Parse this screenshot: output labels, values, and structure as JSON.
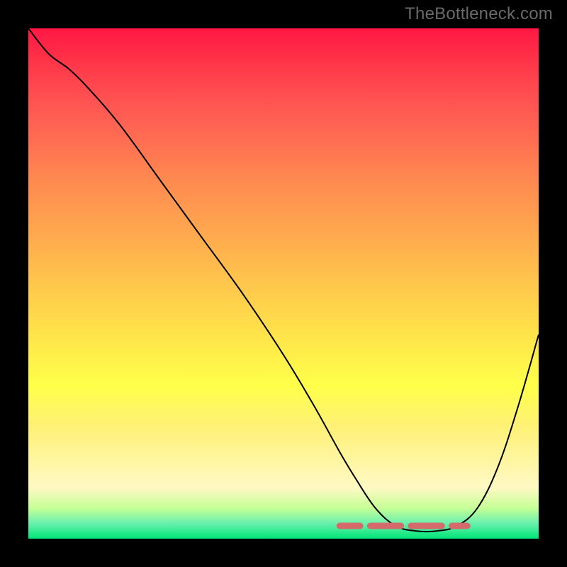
{
  "attribution": "TheBottleneck.com",
  "chart_data": {
    "type": "line",
    "title": "",
    "xlabel": "",
    "ylabel": "",
    "xlim": [
      0,
      100
    ],
    "ylim": [
      0,
      100
    ],
    "series": [
      {
        "name": "bottleneck-curve",
        "x": [
          0,
          4,
          8,
          12,
          18,
          26,
          34,
          42,
          50,
          56,
          61,
          64,
          68,
          72,
          76,
          80,
          84,
          88,
          92,
          96,
          100
        ],
        "y": [
          100,
          95,
          92,
          88,
          81,
          70,
          59,
          48,
          36,
          26,
          17,
          12,
          6,
          2.5,
          1.5,
          1.5,
          2.5,
          6,
          14,
          26,
          40
        ]
      }
    ],
    "markers": {
      "name": "optimal-range-markers",
      "y": 2.5,
      "segments": [
        [
          61,
          65
        ],
        [
          67,
          73
        ],
        [
          75,
          81
        ],
        [
          83,
          86
        ]
      ]
    }
  }
}
